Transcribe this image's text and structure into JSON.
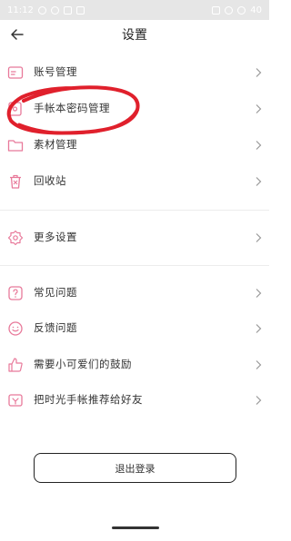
{
  "status_bar": {
    "time": "11:12",
    "battery": "40"
  },
  "header": {
    "title": "设置"
  },
  "menu": [
    {
      "name": "account",
      "label": "账号管理",
      "icon": "account-icon"
    },
    {
      "name": "password",
      "label": "手帐本密码管理",
      "icon": "lock-book-icon"
    },
    {
      "name": "materials",
      "label": "素材管理",
      "icon": "folder-icon"
    },
    {
      "name": "recycle",
      "label": "回收站",
      "icon": "trash-icon"
    },
    {
      "name": "more",
      "label": "更多设置",
      "icon": "gear-icon"
    },
    {
      "name": "faq",
      "label": "常见问题",
      "icon": "question-icon"
    },
    {
      "name": "feedback",
      "label": "反馈问题",
      "icon": "smile-icon"
    },
    {
      "name": "encourage",
      "label": "需要小可爱们的鼓励",
      "icon": "thumbs-up-icon"
    },
    {
      "name": "recommend",
      "label": "把时光手帐推荐给好友",
      "icon": "share-icon"
    }
  ],
  "logout": {
    "label": "退出登录"
  },
  "colors": {
    "accent": "#e8799a",
    "annotation": "#e0202c"
  }
}
